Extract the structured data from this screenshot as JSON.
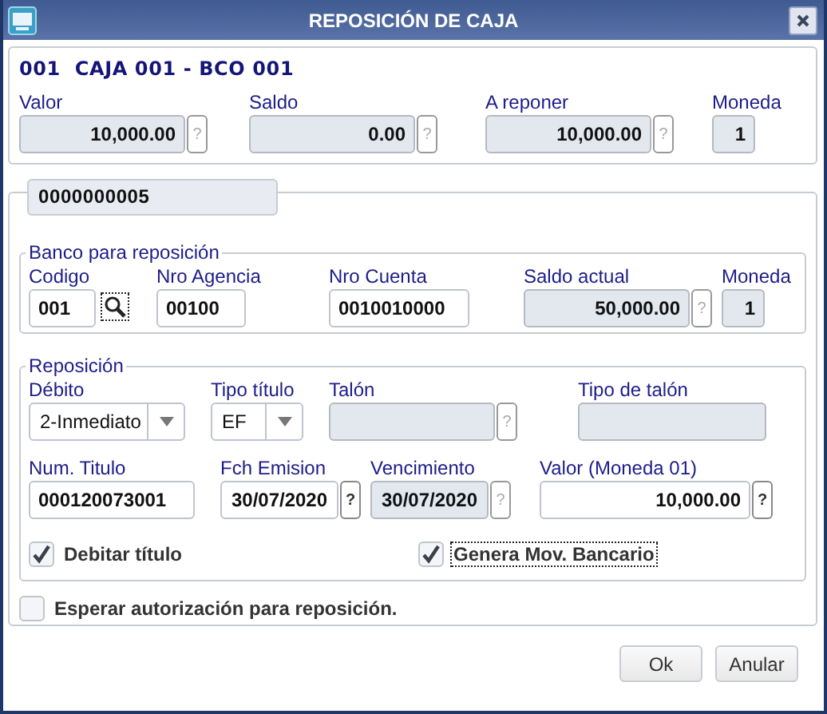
{
  "window": {
    "title": "REPOSICIÓN DE CAJA"
  },
  "header": {
    "title": "001  CAJA 001 - BCO 001",
    "fields": [
      {
        "label": "Valor",
        "value": "10,000.00",
        "kind": "amount",
        "disabled": true,
        "help": {
          "label": "?",
          "disabled": true
        }
      },
      {
        "label": "Saldo",
        "value": "0.00",
        "kind": "amount",
        "disabled": true,
        "help": {
          "label": "?",
          "disabled": true
        }
      },
      {
        "label": "A reponer",
        "value": "10,000.00",
        "kind": "amount",
        "disabled": true,
        "help": {
          "label": "?",
          "disabled": true
        }
      },
      {
        "label": "Moneda",
        "value": "1",
        "kind": "amount",
        "disabled": true
      }
    ]
  },
  "record": {
    "number": "0000000005"
  },
  "bank": {
    "legend": "Banco para reposición",
    "fields": [
      {
        "label": "Codigo",
        "value": "001",
        "kind": "search",
        "disabled": false
      },
      {
        "label": "Nro Agencia",
        "value": "00100",
        "kind": "text",
        "disabled": false
      },
      {
        "label": "Nro Cuenta",
        "value": "0010010000",
        "kind": "text",
        "disabled": false
      },
      {
        "label": "Saldo actual",
        "value": "50,000.00",
        "kind": "amount",
        "disabled": true,
        "help": {
          "label": "?",
          "disabled": true
        }
      },
      {
        "label": "Moneda",
        "value": "1",
        "kind": "amount",
        "disabled": true
      }
    ]
  },
  "replenishment": {
    "legend": "Reposición",
    "row_1": [
      {
        "label": "Débito",
        "value": "2-Inmediato",
        "kind": "select",
        "disabled": false
      },
      {
        "label": "Tipo título",
        "value": "EF",
        "kind": "select",
        "disabled": false
      },
      {
        "label": "Talón",
        "kind": "text",
        "disabled": true,
        "help": {
          "label": "?",
          "disabled": true
        }
      },
      {
        "label": "Tipo de talón",
        "kind": "text",
        "disabled": true
      }
    ],
    "row_2": [
      {
        "label": "Num. Titulo",
        "value": "000120073001",
        "kind": "text",
        "disabled": false
      },
      {
        "label": "Fch Emision",
        "value": "30/07/2020",
        "kind": "date",
        "disabled": false,
        "help": {
          "label": "?",
          "disabled": false
        }
      },
      {
        "label": "Vencimiento",
        "value": "30/07/2020",
        "kind": "date",
        "disabled": true,
        "help": {
          "label": "?",
          "disabled": true
        }
      },
      {
        "label": "Valor (Moneda 01)",
        "value": "10,000.00",
        "kind": "amount",
        "disabled": false,
        "help": {
          "label": "?",
          "disabled": false
        }
      }
    ],
    "checkboxes": [
      {
        "label": "Debitar título",
        "checked": true,
        "focused": false
      },
      {
        "label": "Genera Mov. Bancario",
        "checked": true,
        "focused": true
      }
    ]
  },
  "wait_authorization": {
    "label": "Esperar autorización para reposición.",
    "checked": false
  },
  "buttons": [
    "Ok",
    "Anular"
  ]
}
